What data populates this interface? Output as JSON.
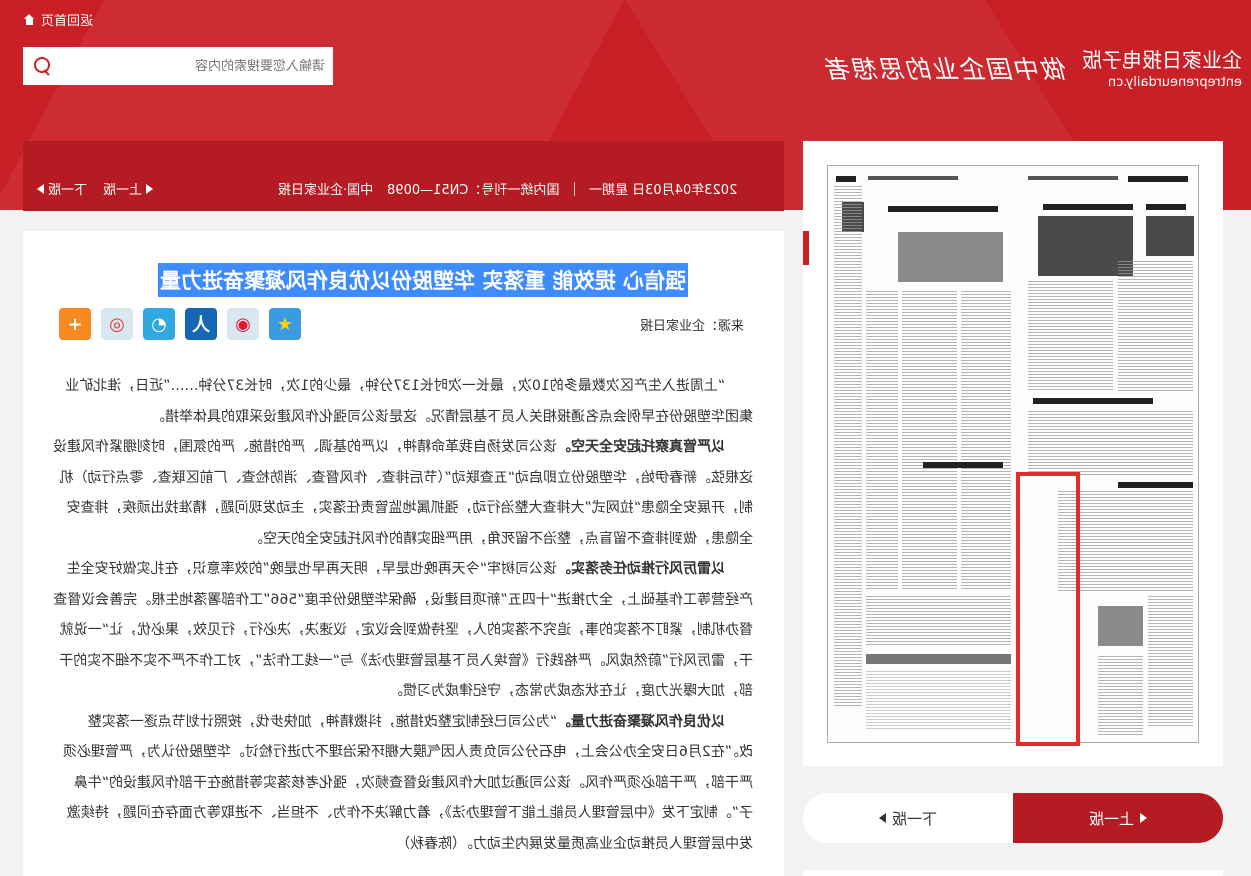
{
  "header": {
    "home_label": "返回首页",
    "search_placeholder": "请输入您要搜索的内容",
    "slogan": "做中国企业的思想者",
    "brand_name": "企业家日报电子版",
    "brand_url": "entrepreneurdaily.cn"
  },
  "info_bar": {
    "prev_label": "上一版",
    "next_label": "下一版",
    "date": "2023年04月03日 星期一",
    "issn": "国内统一刊号：CN51—0098",
    "paper_name": "中国·企业家日报"
  },
  "article": {
    "title": "强信心 提效能 重落实 华塑股份以优良作风凝聚奋进力量",
    "source": "来源：企业家日报",
    "share_icons": [
      "qzone-icon",
      "weibo-icon",
      "renren-icon",
      "tqq-icon",
      "kaixin-icon",
      "more-share-icon"
    ],
    "paragraphs": [
      {
        "lead": "",
        "text": "“上周进入生产区次数最多的10次，最长一次时长137分钟，最少的1次，时长37分钟……”近日，淮北矿业集团华塑股份在早例会点名通报相关人员下基层情况。这是该公司强化作风建设采取的具体举措。"
      },
      {
        "lead": "以严管真察托起安全天空。",
        "text": "该公司发扬自我革命精神，以严的基调、严的措施、严的氛围，时刻绷紧作风建设这根弦。新春伊始，华塑股份立即启动“五查联动”（节后排查、作风督查、消防检查、厂前区联查、零点行动）机制，开展安全隐患“拉网式”大排查大整治行动，强抓属地监管责任落实，主动发现问题，精准找出顽疾，排查安全隐患，做到排查不留盲点，整治不留死角，用严细实精的作风托起安全的天空。"
      },
      {
        "lead": "以雷厉风行推动任务落实。",
        "text": "该公司树牢“今天再晚也是早，明天再早也是晚”的效率意识，在扎实做好安全生产经营等工作基础上，全力推进“十四五”新项目建设，确保华塑股份年度“566”工作部署落地生根。完善会议督查督办机制，紧盯不落实的事，追究不落实的人，坚持做到会议定，议速决，决必行，行见效，果必优，让“一说就干，雷厉风行”蔚然成风。严格践行《管埃入员下基层管理办法》与“一线工作法”，对工作不严不实不细不实的干部，加大曝光力度，让在状态成为常态，守纪律成为习惯。"
      },
      {
        "lead": "以优良作风凝聚奋进力量。",
        "text": "“为公司已经制定整改措施，抖擞精神，加快步伐，按照计划节点逐一落实整改。”在2月6日安全办公会上，电石分公司负责人因气膜大棚环保治理不力进行检讨。华塑股份认为，严管理必须严干部，严干部必须严作风。该公司通过加大作风建设督查频次，强化考核落实等措施在干部作风建设的“牛鼻子”。制定下发《中层管理人员能上能下管理办法》，着力解决不作为、不担当、不进取等方面存在问题，持续激发中层管理人员推动企业高质量发展内生动力。（陈春秋）"
      }
    ]
  },
  "side": {
    "prev_label": "上一版",
    "next_label": "下一版"
  },
  "colors": {
    "brand_red": "#c91f26",
    "bar_red": "#b51b22",
    "highlight": "#3d8bfd",
    "frame_red": "#e52a2a"
  }
}
